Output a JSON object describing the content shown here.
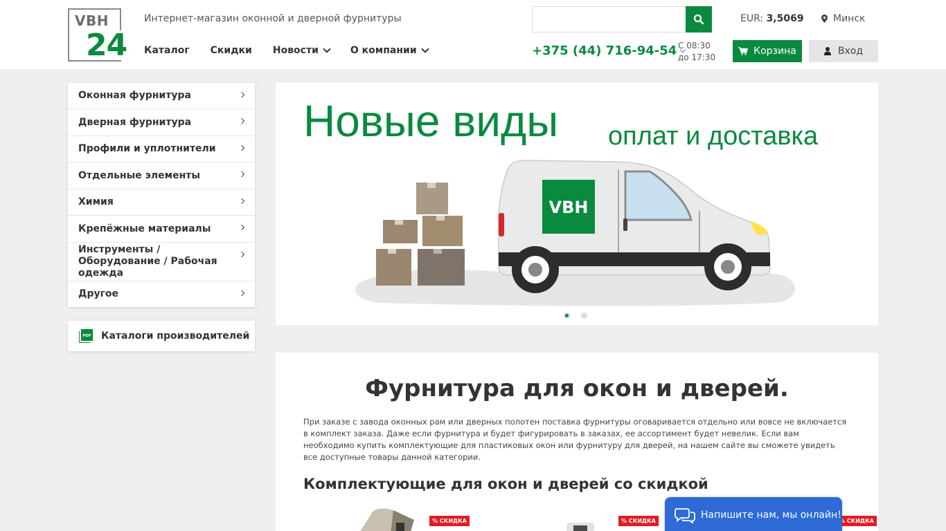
{
  "header": {
    "logo_top": "VBH",
    "logo_bottom": "24",
    "tagline": "Интернет-магазин оконной и дверной фурнитуры",
    "nav": [
      {
        "label": "Каталог",
        "dropdown": false
      },
      {
        "label": "Скидки",
        "dropdown": false
      },
      {
        "label": "Новости",
        "dropdown": true
      },
      {
        "label": "О компании",
        "dropdown": true
      }
    ],
    "search": {
      "value": "",
      "placeholder": ""
    },
    "currency_label": "EUR:",
    "currency_value": "3,5069",
    "city": "Минск",
    "phone": "+375 (44) 716-94-54",
    "hours_from": "С 08:30",
    "hours_to": "до 17:30",
    "cart_label": "Корзина",
    "login_label": "Вход"
  },
  "sidebar": {
    "items": [
      {
        "label": "Оконная фурнитура"
      },
      {
        "label": "Дверная фурнитура"
      },
      {
        "label": "Профили и уплотнители"
      },
      {
        "label": "Отдельные элементы"
      },
      {
        "label": "Химия"
      },
      {
        "label": "Крепёжные материалы"
      },
      {
        "label": "Инструменты / Оборудование / Рабочая одежда"
      },
      {
        "label": "Другое"
      }
    ],
    "catalogs_label": "Каталоги производителей",
    "pdf_icon_text": "PDF"
  },
  "banner": {
    "title": "Новые виды",
    "subtitle": "оплат и доставка",
    "van_logo": "VBH",
    "slides": 2,
    "active_slide": 1
  },
  "content": {
    "heading": "Фурнитура для окон и дверей.",
    "paragraph": "При заказе с завода оконных рам или дверных полотен поставка фурнитуры оговаривается отдельно или вовсе не включается в комплект заказа. Даже если фурнитура и будет фигурировать в заказах, ее ассортимент будет невелик. Если вам необходимо купить комплектующие для пластиковых окон или фурнитуру для дверей, на нашем сайте вы сможете увидеть все доступные товары данной категории.",
    "subheading": "Комплектующие для окон и дверей со скидкой",
    "badge": "% СКИДКА"
  },
  "chat": {
    "label": "Напишите нам, мы онлайн!"
  },
  "colors": {
    "brand": "#0a8a3f",
    "badge": "#e31b23",
    "chat": "#2e6bd6"
  }
}
